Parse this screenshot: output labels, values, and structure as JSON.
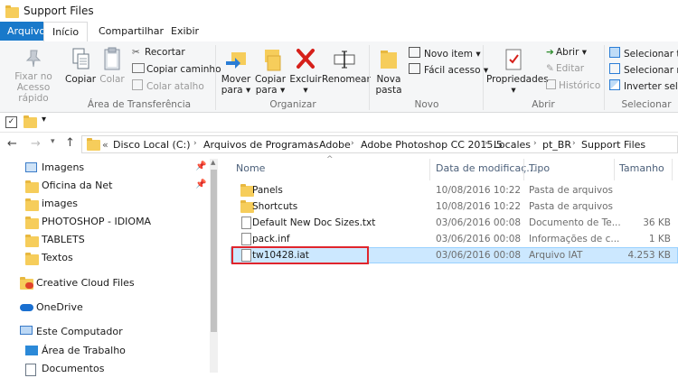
{
  "window": {
    "title": "Support Files"
  },
  "tabs": [
    {
      "label": "Arquivo"
    },
    {
      "label": "Início"
    },
    {
      "label": "Compartilhar"
    },
    {
      "label": "Exibir"
    }
  ],
  "ribbon": {
    "clipboard": {
      "pin": "Fixar no\nAcesso rápido",
      "copy": "Copiar",
      "paste": "Colar",
      "cut": "Recortar",
      "copy_path": "Copiar caminho",
      "paste_shortcut": "Colar atalho",
      "group": "Área de Transferência"
    },
    "organize": {
      "move": "Mover\npara ▾",
      "copy_to": "Copiar\npara ▾",
      "delete": "Excluir\n▾",
      "rename": "Renomear",
      "group": "Organizar"
    },
    "new": {
      "new_folder": "Nova\npasta",
      "new_item": "Novo item ▾",
      "easy_access": "Fácil acesso ▾",
      "group": "Novo"
    },
    "open": {
      "properties": "Propriedades\n▾",
      "open": "Abrir ▾",
      "edit": "Editar",
      "history": "Histórico",
      "group": "Abrir"
    },
    "select": {
      "select_all": "Selecionar tudo",
      "select_none": "Selecionar nenhum",
      "invert": "Inverter seleção",
      "group": "Selecionar"
    }
  },
  "address": {
    "prefix": "«",
    "crumbs": [
      "Disco Local (C:)",
      "Arquivos de Programas",
      "Adobe",
      "Adobe Photoshop CC 2015.5",
      "Locales",
      "pt_BR",
      "Support Files"
    ]
  },
  "nav": [
    {
      "label": "Imagens",
      "pinned": true
    },
    {
      "label": "Oficina da Net",
      "pinned": true
    },
    {
      "label": "images"
    },
    {
      "label": "PHOTOSHOP - IDIOMA"
    },
    {
      "label": "TABLETS"
    },
    {
      "label": "Textos"
    },
    {
      "label": "Creative Cloud Files"
    },
    {
      "label": "OneDrive"
    },
    {
      "label": "Este Computador"
    },
    {
      "label": "Área de Trabalho"
    },
    {
      "label": "Documentos"
    }
  ],
  "columns": {
    "name": "Nome",
    "date": "Data de modificaç...",
    "type": "Tipo",
    "size": "Tamanho"
  },
  "files": [
    {
      "name": "Panels",
      "date": "10/08/2016 10:22",
      "type": "Pasta de arquivos",
      "size": ""
    },
    {
      "name": "Shortcuts",
      "date": "10/08/2016 10:22",
      "type": "Pasta de arquivos",
      "size": ""
    },
    {
      "name": "Default New Doc Sizes.txt",
      "date": "03/06/2016 00:08",
      "type": "Documento de Te...",
      "size": "36 KB"
    },
    {
      "name": "pack.inf",
      "date": "03/06/2016 00:08",
      "type": "Informações de c...",
      "size": "1 KB"
    },
    {
      "name": "tw10428.iat",
      "date": "03/06/2016 00:08",
      "type": "Arquivo IAT",
      "size": "4.253 KB"
    }
  ],
  "colors": {
    "accent": "#1979ca",
    "selection": "#cce8ff",
    "highlight_box": "#e0252c",
    "folder": "#f6cd5b"
  }
}
